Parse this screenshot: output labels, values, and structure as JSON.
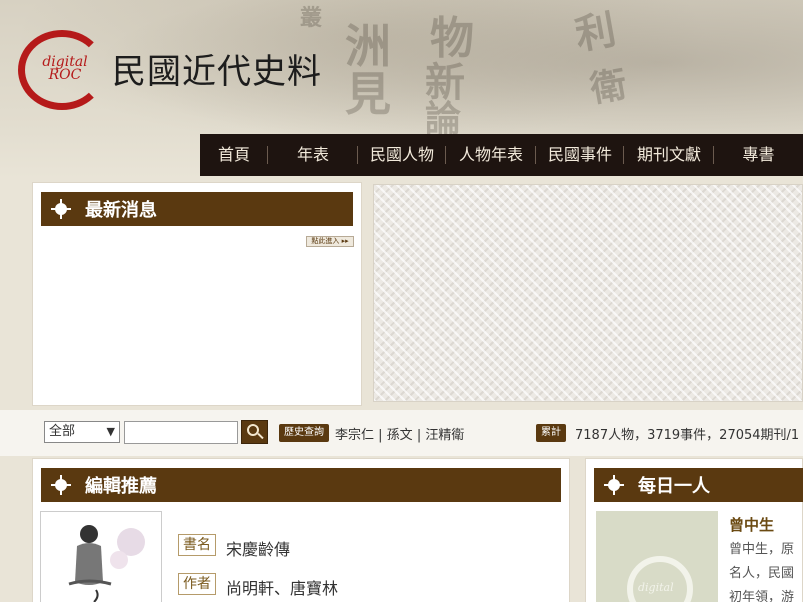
{
  "site": {
    "title": "民國近代史料",
    "logo_text": "digital ROC"
  },
  "nav": [
    "首頁",
    "年表",
    "民國人物",
    "人物年表",
    "民國事件",
    "期刊文獻",
    "專書"
  ],
  "news": {
    "title": "最新消息",
    "enter_label": "點此進入 ▸▸"
  },
  "search": {
    "select_value": "全部",
    "input_value": "",
    "history_label": "歷史查詢",
    "quick_links": [
      "李宗仁",
      "孫文",
      "汪精衛"
    ],
    "stats_label": "累計",
    "stats_text": "7187人物，3719事件，27054期刊/1"
  },
  "editor": {
    "title": "編輯推薦",
    "book_label": "書名",
    "book_value": "宋慶齡傳",
    "author_label": "作者",
    "author_value": "尚明軒、唐寶林"
  },
  "daily": {
    "title": "每日一人",
    "name": "曾中生",
    "desc": "曾中生，原名人，民國初年領，游擊戰"
  }
}
